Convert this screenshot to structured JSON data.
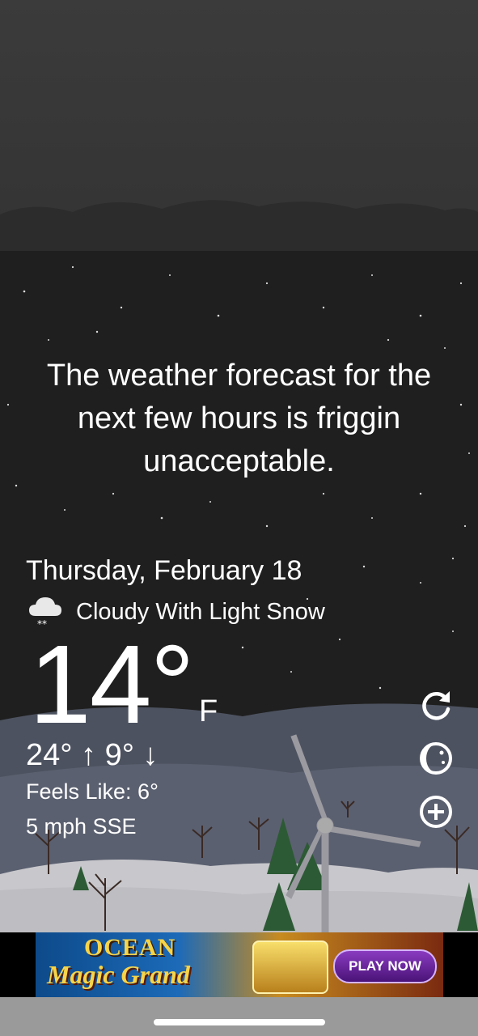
{
  "quote": "The weather forecast for the next few hours is friggin unacceptable.",
  "weather": {
    "date": "Thursday, February 18",
    "condition": "Cloudy With Light Snow",
    "condition_icon": "cloud-snow-icon",
    "temperature": "14°",
    "unit": "F",
    "hi_lo": "24° ↑  9° ↓",
    "feels_like": "Feels Like: 6°",
    "wind": "5 mph SSE"
  },
  "actions": {
    "refresh_icon": "refresh-icon",
    "moon_icon": "moon-phase-icon",
    "add_icon": "add-icon"
  },
  "ad": {
    "title": "OCEAN",
    "subtitle": "Magic Grand",
    "cta": "PLAY NOW"
  },
  "colors": {
    "sky_top": "#3a3a3a",
    "sky_night": "#1f1f1f",
    "hills": "#4d5260",
    "snow": "#c8c8cc",
    "tree": "#2c5a34"
  }
}
